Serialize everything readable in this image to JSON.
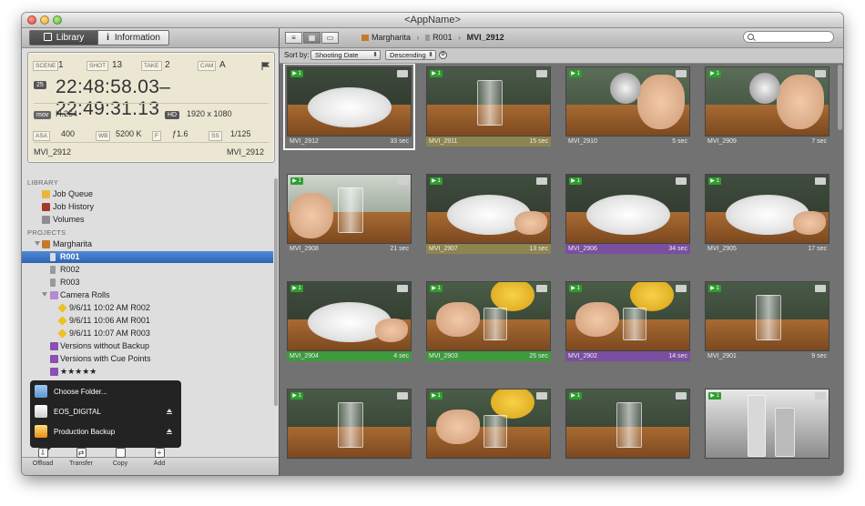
{
  "window": {
    "title": "<AppName>"
  },
  "left_toolbar": {
    "library_label": "Library",
    "information_label": "Information"
  },
  "metadata": {
    "scene_tag": "SCENE",
    "scene": "1",
    "shot_tag": "SHOT",
    "shot": "13",
    "take_tag": "TAKE",
    "take": "2",
    "cam_tag": "CAM",
    "cam": "A",
    "fps": "25",
    "timecode": "22:48:58.03–22:49:31.13",
    "codec_tag": "mov",
    "codec": "H.264",
    "res_tag": "HD",
    "resolution": "1920 x 1080",
    "asa_tag": "ASA",
    "asa": "400",
    "wb_tag": "WB",
    "wb": "5200 K",
    "f_tag": "F",
    "aperture": "ƒ1.6",
    "ss_tag": "SS",
    "shutter": "1/125",
    "name_left": "MVI_2912",
    "name_right": "MVI_2912"
  },
  "sidebar": {
    "library_header": "LIBRARY",
    "library_items": [
      {
        "label": "Job Queue",
        "icon": "job-queue-icon",
        "color": "#e8b83a"
      },
      {
        "label": "Job History",
        "icon": "job-history-icon",
        "color": "#a33a2a"
      },
      {
        "label": "Volumes",
        "icon": "volume-icon",
        "color": "#8e8e8e"
      }
    ],
    "projects_header": "PROJECTS",
    "project_name": "Margharita",
    "rolls": [
      {
        "label": "R001",
        "selected": true
      },
      {
        "label": "R002",
        "selected": false
      },
      {
        "label": "R003",
        "selected": false
      }
    ],
    "camera_rolls_label": "Camera Rolls",
    "camera_rolls": [
      {
        "label": "9/6/11 10:02 AM R002"
      },
      {
        "label": "9/6/11 10:06 AM R001"
      },
      {
        "label": "9/6/11 10:07 AM R003"
      }
    ],
    "smart_items": [
      {
        "label": "Versions without Backup"
      },
      {
        "label": "Versions with Cue Points"
      },
      {
        "label": "★★★★★"
      }
    ]
  },
  "offload_popup": {
    "items": [
      {
        "label": "Choose Folder...",
        "icon": "folder-icon",
        "eject": false
      },
      {
        "label": "EOS_DIGITAL",
        "icon": "disk-icon",
        "eject": true
      },
      {
        "label": "Production Backup",
        "icon": "backup-disk-icon",
        "eject": true
      }
    ]
  },
  "bottom_buttons": [
    {
      "label": "Offload",
      "icon": "offload-icon"
    },
    {
      "label": "Transfer",
      "icon": "transfer-icon"
    },
    {
      "label": "Copy",
      "icon": "copy-icon"
    },
    {
      "label": "Add",
      "icon": "add-icon"
    }
  ],
  "main_toolbar": {
    "view_buttons": [
      "list-view-icon",
      "grid-view-icon",
      "filmstrip-view-icon"
    ],
    "breadcrumb": {
      "project": "Margharita",
      "roll": "R001",
      "clip": "MVI_2912"
    },
    "search_placeholder": ""
  },
  "sortbar": {
    "label": "Sort by:",
    "sort_field": "Shooting Date",
    "sort_order": "Descending"
  },
  "clips": [
    {
      "name": "MVI_2912",
      "duration": "33 sec",
      "label_color": "",
      "selected": true,
      "scene": "plate"
    },
    {
      "name": "MVI_2911",
      "duration": "15 sec",
      "label_color": "#8d8550",
      "selected": false,
      "scene": "glass"
    },
    {
      "name": "MVI_2910",
      "duration": "5 sec",
      "label_color": "",
      "selected": false,
      "scene": "strainer"
    },
    {
      "name": "MVI_2909",
      "duration": "7 sec",
      "label_color": "",
      "selected": false,
      "scene": "strainer"
    },
    {
      "name": "MVI_2908",
      "duration": "21 sec",
      "label_color": "",
      "selected": false,
      "scene": "pour"
    },
    {
      "name": "MVI_2907",
      "duration": "13 sec",
      "label_color": "#8d8550",
      "selected": false,
      "scene": "plate-hand"
    },
    {
      "name": "MVI_2906",
      "duration": "34 sec",
      "label_color": "#7a4fa0",
      "selected": false,
      "scene": "plate"
    },
    {
      "name": "MVI_2905",
      "duration": "17 sec",
      "label_color": "",
      "selected": false,
      "scene": "plate-hand"
    },
    {
      "name": "MVI_2904",
      "duration": "4 sec",
      "label_color": "#3f9a3f",
      "selected": false,
      "scene": "plate-hand"
    },
    {
      "name": "MVI_2903",
      "duration": "25 sec",
      "label_color": "#3f9a3f",
      "selected": false,
      "scene": "juicer"
    },
    {
      "name": "MVI_2902",
      "duration": "14 sec",
      "label_color": "#7a4fa0",
      "selected": false,
      "scene": "juicer"
    },
    {
      "name": "MVI_2901",
      "duration": "9 sec",
      "label_color": "",
      "selected": false,
      "scene": "glass"
    },
    {
      "name": "",
      "duration": "",
      "label_color": "",
      "selected": false,
      "scene": "glass"
    },
    {
      "name": "",
      "duration": "",
      "label_color": "",
      "selected": false,
      "scene": "juicer"
    },
    {
      "name": "",
      "duration": "",
      "label_color": "",
      "selected": false,
      "scene": "glass"
    },
    {
      "name": "",
      "duration": "",
      "label_color": "",
      "selected": false,
      "scene": "bottles"
    }
  ]
}
